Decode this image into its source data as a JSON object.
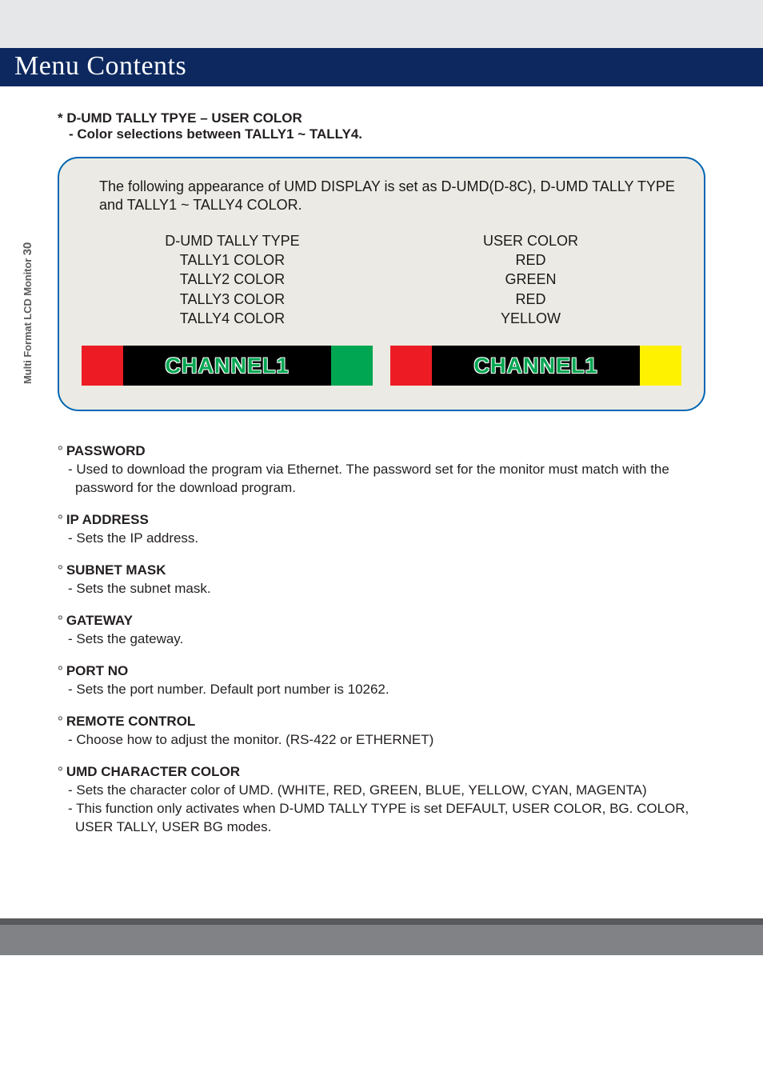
{
  "title": "Menu Contents",
  "side_label_text": "Multi Format LCD Monitor",
  "side_label_page": "30",
  "intro": {
    "star_line": "* D-UMD TALLY TPYE – USER COLOR",
    "sub_line": "- Color selections between TALLY1 ~ TALLY4."
  },
  "panel": {
    "note": "The following appearance of UMD DISPLAY is set as D-UMD(D-8C), D-UMD TALLY TYPE and TALLY1 ~ TALLY4 COLOR.",
    "settings": {
      "left": [
        "D-UMD TALLY TYPE",
        "TALLY1 COLOR",
        "TALLY2 COLOR",
        "TALLY3 COLOR",
        "TALLY4 COLOR"
      ],
      "right": [
        "USER COLOR",
        "RED",
        "GREEN",
        "RED",
        "YELLOW"
      ]
    },
    "channels": [
      {
        "label": "CHANNEL1",
        "left_seg": "#ed1c24",
        "mid_bg": "#000000",
        "right_seg": "#00a651"
      },
      {
        "label": "CHANNEL1",
        "left_seg": "#ed1c24",
        "mid_bg": "#000000",
        "right_seg": "#fff200"
      }
    ]
  },
  "items": [
    {
      "head": "PASSWORD",
      "body": [
        "- Used to download the program via Ethernet. The password set for the monitor must match with the password for the download program."
      ]
    },
    {
      "head": "IP ADDRESS",
      "body": [
        "- Sets the IP address."
      ]
    },
    {
      "head": "SUBNET MASK",
      "body": [
        "- Sets the subnet mask."
      ]
    },
    {
      "head": "GATEWAY",
      "body": [
        "- Sets the gateway."
      ]
    },
    {
      "head": "PORT NO",
      "body": [
        "- Sets the port number. Default port number is 10262."
      ]
    },
    {
      "head": "REMOTE CONTROL",
      "body": [
        "-  Choose how to adjust the monitor. (RS-422 or ETHERNET)"
      ]
    },
    {
      "head": "UMD CHARACTER COLOR",
      "body": [
        "-  Sets the character color of UMD. (WHITE, RED, GREEN, BLUE, YELLOW, CYAN, MAGENTA)",
        "-  This function only activates when D-UMD TALLY TYPE is set DEFAULT, USER COLOR, BG. COLOR, USER TALLY, USER BG modes."
      ]
    }
  ]
}
